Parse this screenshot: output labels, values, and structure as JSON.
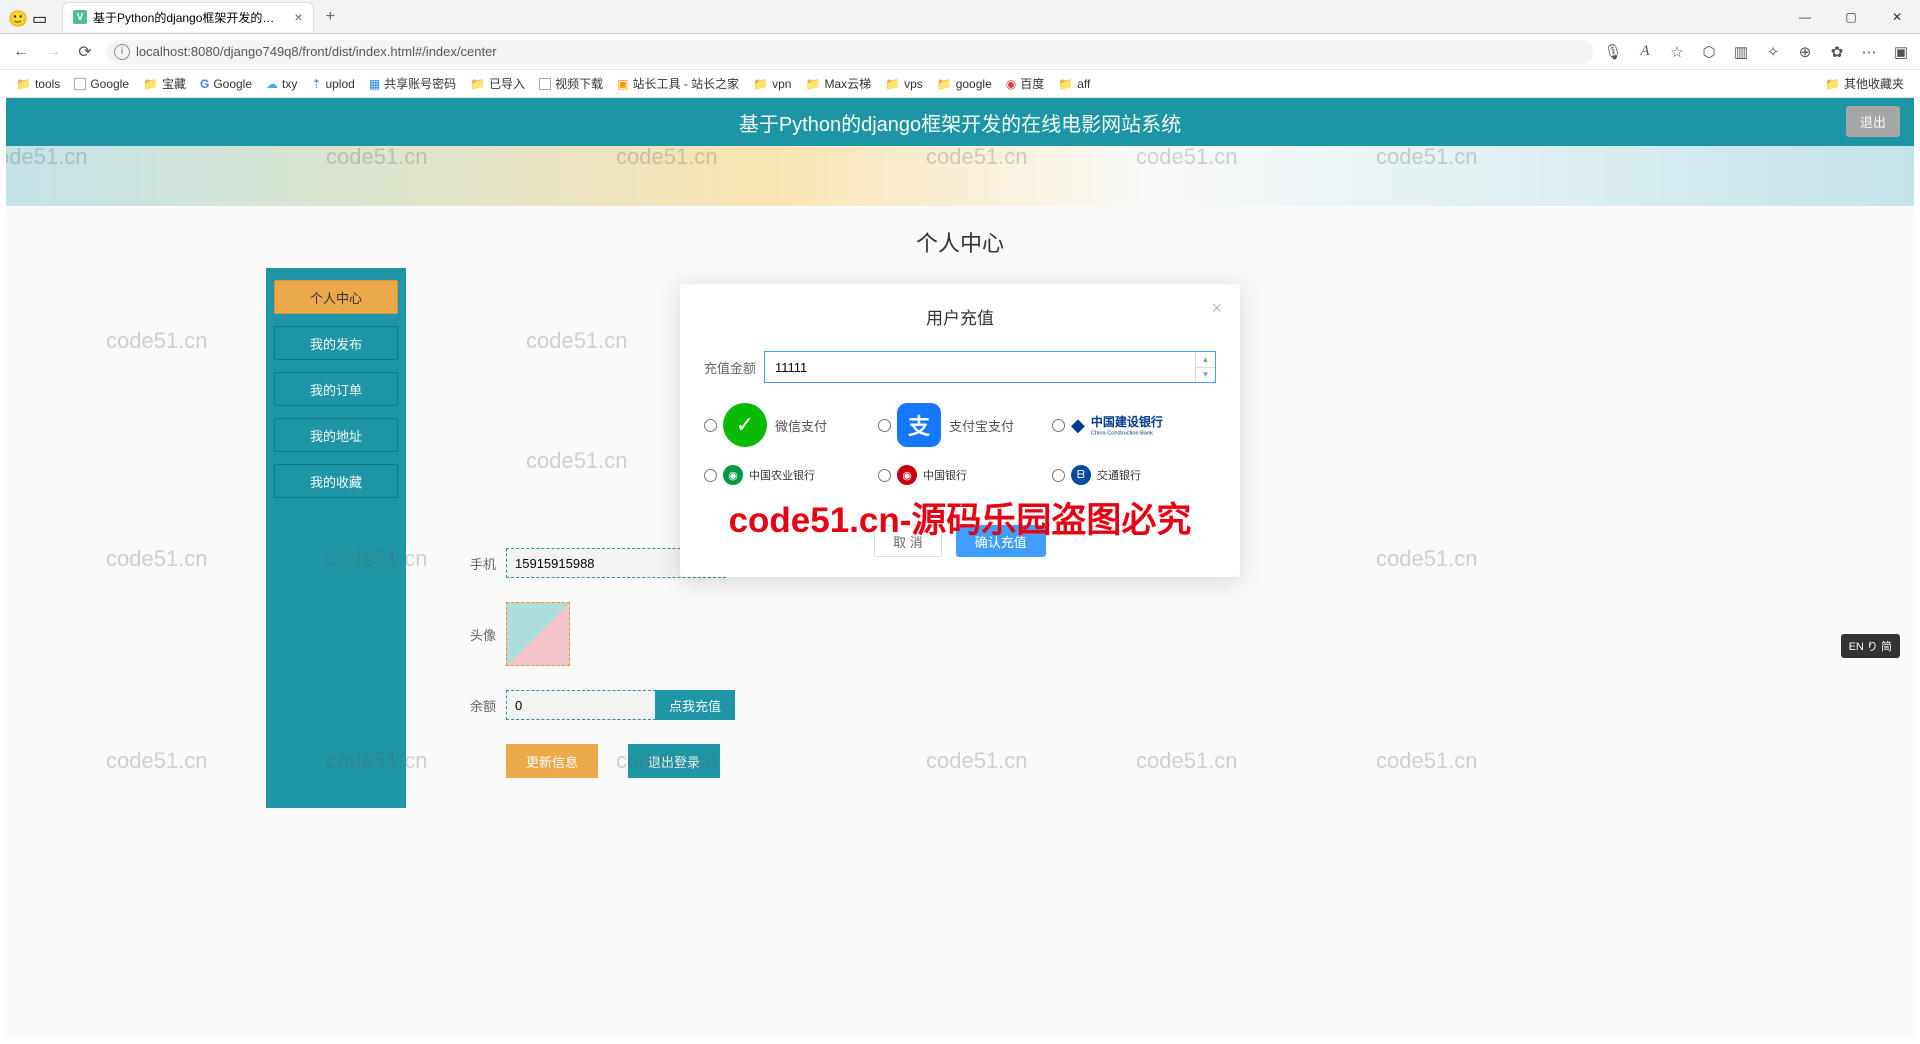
{
  "browser": {
    "tab_title": "基于Python的django框架开发的…",
    "url": "localhost:8080/django749q8/front/dist/index.html#/index/center",
    "bookmarks": [
      "tools",
      "Google",
      "宝藏",
      "Google",
      "txy",
      "uplod",
      "共享账号密码",
      "已导入",
      "视频下载",
      "站长工具 - 站长之家",
      "vpn",
      "Max云梯",
      "vps",
      "google",
      "百度",
      "aff"
    ],
    "other_bookmarks": "其他收藏夹"
  },
  "page": {
    "header_title": "基于Python的django框架开发的在线电影网站系统",
    "logout": "退出",
    "center_title": "个人中心",
    "sidebar": [
      "个人中心",
      "我的发布",
      "我的订单",
      "我的地址",
      "我的收藏"
    ],
    "form": {
      "phone_label": "手机",
      "phone_value": "15915915988",
      "avatar_label": "头像",
      "balance_label": "余额",
      "balance_value": "0",
      "recharge_btn": "点我充值",
      "update_btn": "更新信息",
      "logout_btn": "退出登录"
    }
  },
  "modal": {
    "title": "用户充值",
    "amount_label": "充值金额",
    "amount_value": "11111",
    "pay_options": {
      "wechat": "微信支付",
      "alipay": "支付宝支付",
      "ccb_cn": "中国建设银行",
      "ccb_en": "China Construction Bank",
      "abc": "中国农业银行",
      "boc": "中国银行",
      "comm": "交通银行"
    },
    "cancel": "取 消",
    "confirm": "确认充值"
  },
  "watermark": {
    "small": "code51.cn",
    "big": "code51.cn-源码乐园盗图必究"
  },
  "ime": "EN り 简"
}
